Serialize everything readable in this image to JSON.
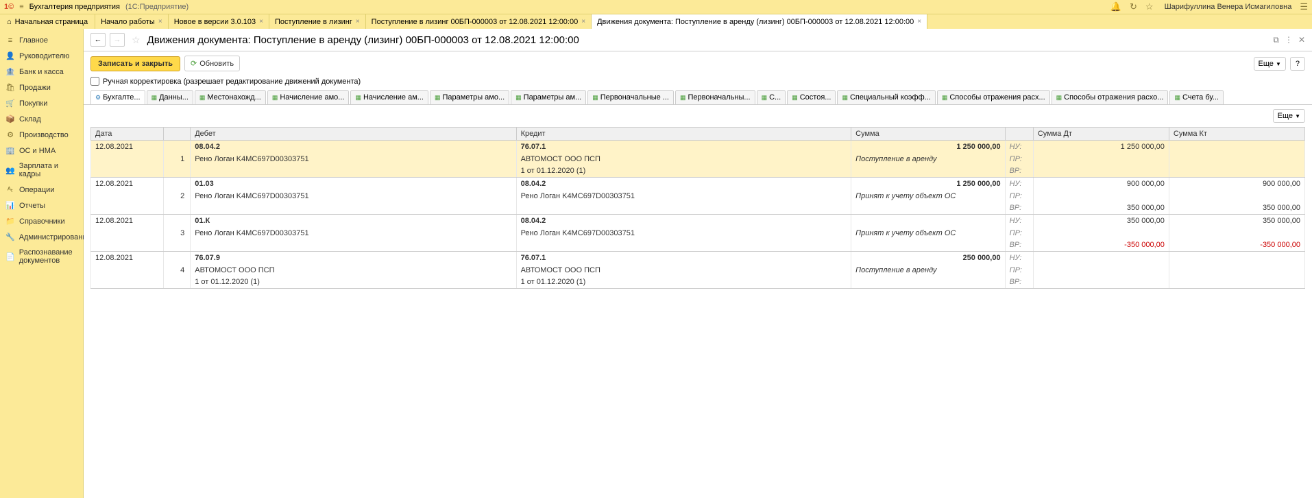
{
  "titlebar": {
    "app_name": "Бухгалтерия предприятия",
    "app_suffix": "(1С:Предприятие)",
    "user": "Шарифуллина Венера Исмагиловна"
  },
  "tabs": {
    "home": "Начальная страница",
    "items": [
      {
        "label": "Начало работы"
      },
      {
        "label": "Новое в версии 3.0.103"
      },
      {
        "label": "Поступление в лизинг"
      },
      {
        "label": "Поступление в лизинг 00БП-000003 от 12.08.2021 12:00:00"
      },
      {
        "label": "Движения документа: Поступление в аренду (лизинг) 00БП-000003 от 12.08.2021 12:00:00",
        "active": true
      }
    ]
  },
  "sidebar": {
    "items": [
      {
        "icon": "≡",
        "label": "Главное"
      },
      {
        "icon": "👤",
        "label": "Руководителю"
      },
      {
        "icon": "🏦",
        "label": "Банк и касса"
      },
      {
        "icon": "🛍",
        "label": "Продажи"
      },
      {
        "icon": "🛒",
        "label": "Покупки"
      },
      {
        "icon": "📦",
        "label": "Склад"
      },
      {
        "icon": "⚙",
        "label": "Производство"
      },
      {
        "icon": "🏢",
        "label": "ОС и НМА"
      },
      {
        "icon": "👥",
        "label": "Зарплата и кадры"
      },
      {
        "icon": "ᴬₜ",
        "label": "Операции"
      },
      {
        "icon": "📊",
        "label": "Отчеты"
      },
      {
        "icon": "📁",
        "label": "Справочники"
      },
      {
        "icon": "🔧",
        "label": "Администрирование"
      },
      {
        "icon": "📄",
        "label": "Распознавание документов"
      }
    ]
  },
  "doc": {
    "title": "Движения документа: Поступление в аренду (лизинг) 00БП-000003 от 12.08.2021 12:00:00"
  },
  "toolbar": {
    "save_label": "Записать и закрыть",
    "refresh_label": "Обновить",
    "more_label": "Еще",
    "help_label": "?"
  },
  "checkbox": {
    "label": "Ручная корректировка (разрешает редактирование движений документа)"
  },
  "subtabs": [
    "Бухгалте...",
    "Данны...",
    "Местонахожд...",
    "Начисление амо...",
    "Начисление ам...",
    "Параметры амо...",
    "Параметры ам...",
    "Первоначальные ...",
    "Первоначальны...",
    "С...",
    "Состоя...",
    "Специальный коэфф...",
    "Способы отражения расх...",
    "Способы отражения расхо...",
    "Счета бу..."
  ],
  "table": {
    "headers": {
      "date": "Дата",
      "debit": "Дебет",
      "credit": "Кредит",
      "sum": "Сумма",
      "sum_dt": "Сумма Дт",
      "sum_kt": "Сумма Кт"
    },
    "groups": [
      {
        "selected": true,
        "rows": [
          {
            "date": "12.08.2021",
            "num": "",
            "debit": "08.04.2",
            "credit": "76.07.1",
            "sum": "1 250 000,00",
            "type": "НУ:",
            "dt": "1 250 000,00",
            "kt": "",
            "bold": true
          },
          {
            "date": "",
            "num": "1",
            "debit": "Рено Логан K4MC697D00303751",
            "credit": "АВТОМОСТ ООО ПСП",
            "sum": "Поступление в аренду",
            "type": "ПР:",
            "dt": "",
            "kt": "",
            "italic_sum": true
          },
          {
            "date": "",
            "num": "",
            "debit": "",
            "credit": "1 от 01.12.2020 (1)",
            "sum": "",
            "type": "ВР:",
            "dt": "",
            "kt": ""
          }
        ]
      },
      {
        "rows": [
          {
            "date": "12.08.2021",
            "num": "",
            "debit": "01.03",
            "credit": "08.04.2",
            "sum": "1 250 000,00",
            "type": "НУ:",
            "dt": "900 000,00",
            "kt": "900 000,00",
            "bold": true
          },
          {
            "date": "",
            "num": "2",
            "debit": "Рено Логан K4MC697D00303751",
            "credit": "Рено Логан K4MC697D00303751",
            "sum": "Принят к учету объект ОС",
            "type": "ПР:",
            "dt": "",
            "kt": "",
            "italic_sum": true
          },
          {
            "date": "",
            "num": "",
            "debit": "",
            "credit": "",
            "sum": "",
            "type": "ВР:",
            "dt": "350 000,00",
            "kt": "350 000,00"
          }
        ]
      },
      {
        "rows": [
          {
            "date": "12.08.2021",
            "num": "",
            "debit": "01.К",
            "credit": "08.04.2",
            "sum": "",
            "type": "НУ:",
            "dt": "350 000,00",
            "kt": "350 000,00",
            "bold": true
          },
          {
            "date": "",
            "num": "3",
            "debit": "Рено Логан K4MC697D00303751",
            "credit": "Рено Логан K4MC697D00303751",
            "sum": "Принят к учету объект ОС",
            "type": "ПР:",
            "dt": "",
            "kt": "",
            "italic_sum": true
          },
          {
            "date": "",
            "num": "",
            "debit": "",
            "credit": "",
            "sum": "",
            "type": "ВР:",
            "dt": "-350 000,00",
            "kt": "-350 000,00",
            "red": true
          }
        ]
      },
      {
        "rows": [
          {
            "date": "12.08.2021",
            "num": "",
            "debit": "76.07.9",
            "credit": "76.07.1",
            "sum": "250 000,00",
            "type": "НУ:",
            "dt": "",
            "kt": "",
            "bold": true
          },
          {
            "date": "",
            "num": "4",
            "debit": "АВТОМОСТ ООО ПСП",
            "credit": "АВТОМОСТ ООО ПСП",
            "sum": "Поступление в аренду",
            "type": "ПР:",
            "dt": "",
            "kt": "",
            "italic_sum": true
          },
          {
            "date": "",
            "num": "",
            "debit": "1 от 01.12.2020 (1)",
            "credit": "1 от 01.12.2020 (1)",
            "sum": "",
            "type": "ВР:",
            "dt": "",
            "kt": ""
          }
        ]
      }
    ]
  }
}
